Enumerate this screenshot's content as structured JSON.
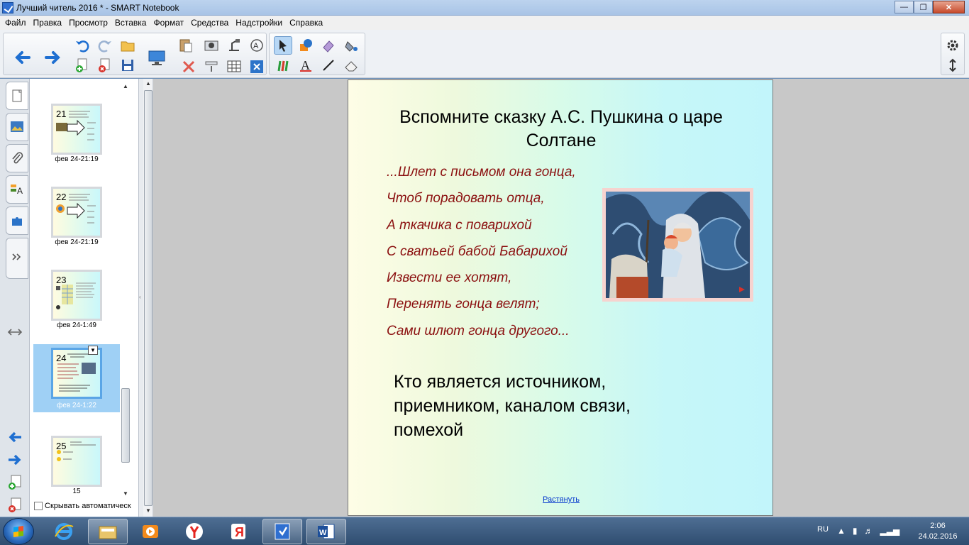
{
  "window": {
    "title": "Лучший читель 2016 * - SMART Notebook"
  },
  "menu": [
    "Файл",
    "Правка",
    "Просмотр",
    "Вставка",
    "Формат",
    "Средства",
    "Надстройки",
    "Справка"
  ],
  "toolbar": {
    "icons": [
      "back-arrow-icon",
      "forward-arrow-icon",
      "undo-icon",
      "redo-icon",
      "open-icon",
      "add-page-icon",
      "delete-page-icon",
      "save-icon",
      "display-icon",
      "paste-icon",
      "screen-capture-icon",
      "document-camera-icon",
      "text-recognition-icon",
      "delete-icon",
      "screen-shade-icon",
      "table-icon",
      "fullscreen-icon",
      "select-icon",
      "shapes-icon",
      "magic-pen-icon",
      "fill-icon",
      "pens-icon",
      "text-icon",
      "line-icon",
      "eraser-icon",
      "settings-icon",
      "move-toolbar-icon"
    ]
  },
  "sorter": {
    "pages": [
      {
        "number": "21",
        "caption": "фев 24-21:19"
      },
      {
        "number": "22",
        "caption": "фев 24-21:19"
      },
      {
        "number": "23",
        "caption": "фев 24-1:49"
      },
      {
        "number": "24",
        "caption": "фев 24-1:22",
        "selected": true
      },
      {
        "number": "25",
        "caption": "15"
      }
    ],
    "auto_hide_label": "Скрывать автоматическ"
  },
  "slide": {
    "title": "Вспомните сказку А.С. Пушкина о царе Солтане",
    "poem_lines": [
      "...Шлет с письмом она гонца,",
      "Чтоб порадовать отца,",
      "А ткачика с поварихой",
      "С сватьей бабой Бабарихой",
      "Извести ее хотят,",
      "Перенять гонца велят;",
      "Сами шлют гонца другого..."
    ],
    "question": "Кто является источником, приемником, каналом связи, помехой",
    "stretch_link": "Растянуть",
    "colors": {
      "poem": "#8b1010",
      "text": "#000000",
      "link": "#0033cc"
    }
  },
  "taskbar": {
    "apps": [
      "start-button",
      "internet-explorer-icon",
      "explorer-folder-icon",
      "media-player-icon",
      "yandex-browser-icon",
      "yandex-icon",
      "smart-notebook-icon",
      "word-icon"
    ],
    "language": "RU",
    "time": "2:06",
    "date": "24.02.2016"
  }
}
